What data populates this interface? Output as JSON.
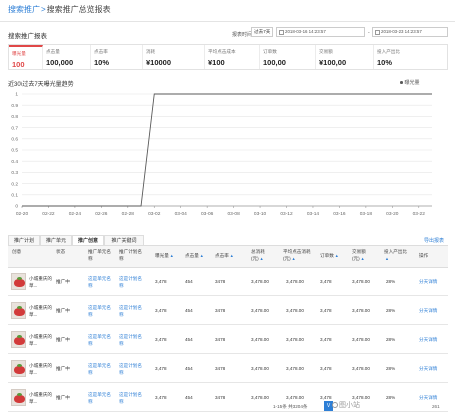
{
  "breadcrumb": {
    "parent": "搜索推广",
    "separator": ">",
    "current": "搜索推广总览报表"
  },
  "section_title": "搜索推广报表",
  "date_range": {
    "label": "报表时间:",
    "preset": "过去7天",
    "start": "2018-03-16  14:23:57",
    "separator": "-",
    "end": "2018-03-23  14:23:57"
  },
  "metrics": [
    {
      "label": "曝光量",
      "value": "100",
      "active": true
    },
    {
      "label": "点击量",
      "value": "100,000",
      "active": false
    },
    {
      "label": "点击率",
      "value": "10%",
      "active": false
    },
    {
      "label": "消耗",
      "value": "¥10000",
      "active": false
    },
    {
      "label": "平均点击成本",
      "value": "¥100",
      "active": false
    },
    {
      "label": "订单数",
      "value": "100,00",
      "active": false
    },
    {
      "label": "交易额",
      "value": "¥100,00",
      "active": false
    },
    {
      "label": "投入产出比",
      "value": "10%",
      "active": false
    }
  ],
  "chart_data": {
    "type": "line",
    "title": "近30\\过去7天曝光量趋势",
    "legend": [
      "曝光量"
    ],
    "legend_position": "top-right",
    "grid": true,
    "ylim": [
      0,
      1
    ],
    "yticks": [
      "0",
      "0.1",
      "0.2",
      "0.3",
      "0.4",
      "0.5",
      "0.6",
      "0.7",
      "0.8",
      "0.9",
      "1"
    ],
    "xticks": [
      "02-20",
      "02-22",
      "02-24",
      "02-26",
      "02-28",
      "03-02",
      "03-04",
      "03-06",
      "03-08",
      "03-10",
      "03-12",
      "03-14",
      "03-16",
      "03-18",
      "03-20",
      "03-22"
    ],
    "series": [
      {
        "name": "曝光量",
        "x": [
          "02-20",
          "03-01",
          "03-02",
          "03-23"
        ],
        "values": [
          0,
          0,
          1,
          1
        ]
      }
    ],
    "color": "#5a5a5a"
  },
  "tabs": [
    {
      "label": "推广计划",
      "active": false
    },
    {
      "label": "推广单元",
      "active": false
    },
    {
      "label": "推广创意",
      "active": true
    },
    {
      "label": "推广关键词",
      "active": false
    }
  ],
  "export_label": "导出报表",
  "table": {
    "headers": [
      "创意",
      "状态",
      "推广单元名称",
      "推广计划名称",
      "曝光量",
      "点击量",
      "点击率",
      "总消耗(元)",
      "平均点击消耗(元)",
      "订单数",
      "交易额(元)",
      "投入产出比",
      "操作"
    ],
    "rows": [
      {
        "title": "小城重庆的草...",
        "status": "推广中",
        "unit": "这是单元名称",
        "plan": "这是计划名称",
        "impressions": "3,478",
        "clicks": "454",
        "ctr": "3478",
        "cost": "3,478.00",
        "avg_cost": "3,478.00",
        "orders": "3,478",
        "revenue": "3,478.00",
        "roi": "28%",
        "action": "分天详情"
      },
      {
        "title": "小城重庆的草...",
        "status": "推广中",
        "unit": "这是单元名称",
        "plan": "这是计划名称",
        "impressions": "3,478",
        "clicks": "454",
        "ctr": "3478",
        "cost": "3,478.00",
        "avg_cost": "3,478.00",
        "orders": "3,478",
        "revenue": "3,478.00",
        "roi": "28%",
        "action": "分天详情"
      },
      {
        "title": "小城重庆的草...",
        "status": "推广中",
        "unit": "这是单元名称",
        "plan": "这是计划名称",
        "impressions": "3,478",
        "clicks": "454",
        "ctr": "3478",
        "cost": "3,478.00",
        "avg_cost": "3,478.00",
        "orders": "3,478",
        "revenue": "3,478.00",
        "roi": "28%",
        "action": "分天详情"
      },
      {
        "title": "小城重庆的草...",
        "status": "推广中",
        "unit": "这是单元名称",
        "plan": "这是计划名称",
        "impressions": "3,478",
        "clicks": "454",
        "ctr": "3478",
        "cost": "3,478.00",
        "avg_cost": "3,478.00",
        "orders": "3,478",
        "revenue": "3,478.00",
        "roi": "28%",
        "action": "分天详情"
      },
      {
        "title": "小城重庆的草...",
        "status": "推广中",
        "unit": "这是单元名称",
        "plan": "这是计划名称",
        "impressions": "3,478",
        "clicks": "454",
        "ctr": "3478",
        "cost": "3,478.00",
        "avg_cost": "3,478.00",
        "orders": "3,478",
        "revenue": "3,478.00",
        "roi": "28%",
        "action": "分天详情"
      }
    ]
  },
  "pagination": {
    "summary": "1-15条  共3204条",
    "current": "V"
  },
  "watermark": "图小站",
  "page_number": "261"
}
